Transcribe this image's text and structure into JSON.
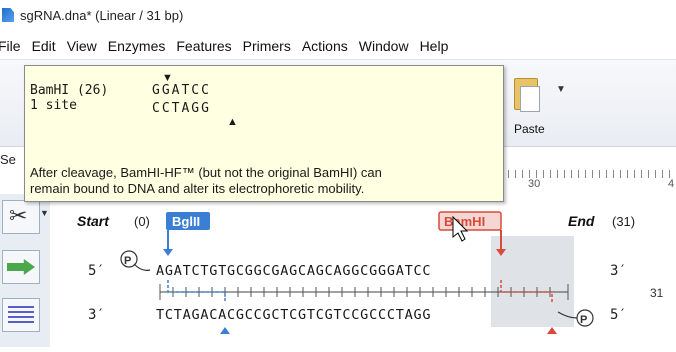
{
  "window": {
    "title": "sgRNA.dna* (Linear / 31 bp)"
  },
  "menu": [
    "File",
    "Edit",
    "View",
    "Enzymes",
    "Features",
    "Primers",
    "Actions",
    "Window",
    "Help"
  ],
  "toolbar": {
    "paste_label": "Paste"
  },
  "tab_fragment": "Se",
  "ruler": {
    "labels": [
      "30",
      "4"
    ]
  },
  "map": {
    "start_label": "Start",
    "start_pos": "(0)",
    "end_label": "End",
    "end_pos": "(31)",
    "bglii_label": "BglII",
    "bamhi_label": "BamHI",
    "five_prime": "5′",
    "three_prime": "3′",
    "top_strand": "AGATCTGTGCGGCGAGCAGCAGGCGGGATCC",
    "bottom_strand": "TCTAGACACGCCGCTCGTCGTCCGCCCTAGG",
    "length_label": "31",
    "promoter_symbol": "P"
  },
  "tooltip": {
    "enzyme": "BamHI (26)",
    "sites": "1 site",
    "site_top": "GGATCC",
    "site_bottom": "CCTAGG",
    "note_line1": "After cleavage, BamHI-HF™ (but not the original BamHI) can",
    "note_line2": "remain bound to DNA and alter its electrophoretic mobility."
  },
  "colors": {
    "bglii": "#3b7fd4",
    "bamhi": "#d94a3a",
    "tooltip_bg": "#ffffe1",
    "highlight": "#dfe3e8"
  },
  "icons": [
    "scissors-icon",
    "arrow-right-icon",
    "lines-icon",
    "paste-icon",
    "promoter-icon",
    "cursor-icon"
  ]
}
